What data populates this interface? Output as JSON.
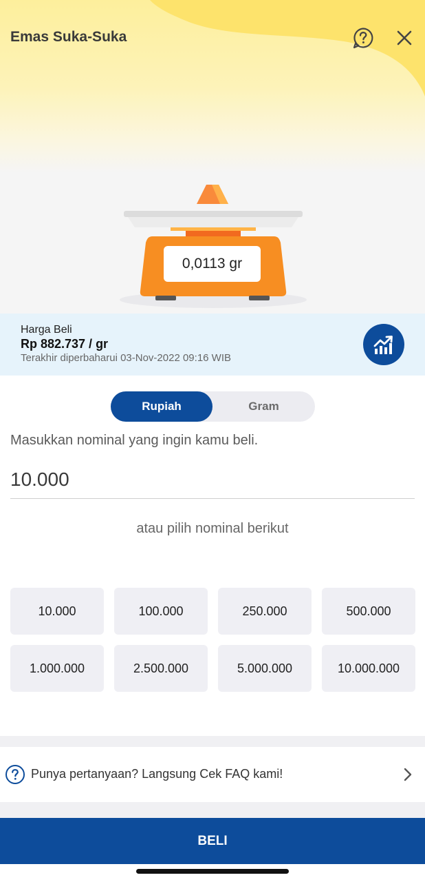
{
  "header": {
    "title": "Emas Suka-Suka",
    "help_icon": "help-icon",
    "close_icon": "close-icon"
  },
  "hero": {
    "weight_display": "0,0113 gr",
    "colors": {
      "yellow": "#fde36c",
      "scale_orange": "#f78e22"
    }
  },
  "price": {
    "label": "Harga Beli",
    "value": "Rp 882.737 / gr",
    "updated": "Terakhir diperbaharui 03-Nov-2022 09:16 WIB",
    "chart_icon": "trend-chart-icon"
  },
  "mode_toggle": {
    "selected": "Rupiah",
    "options": [
      "Rupiah",
      "Gram"
    ]
  },
  "form": {
    "prompt": "Masukkan nominal yang ingin kamu beli.",
    "amount_value": "10.000",
    "or_text": "atau pilih nominal berikut"
  },
  "presets": [
    "10.000",
    "100.000",
    "250.000",
    "500.000",
    "1.000.000",
    "2.500.000",
    "5.000.000",
    "10.000.000"
  ],
  "faq": {
    "text": "Punya pertanyaan? Langsung Cek FAQ kami!"
  },
  "buy_button": {
    "label": "BELI"
  },
  "colors": {
    "primary": "#0d4c9b",
    "price_bar_bg": "#e6f3fb",
    "chip_bg": "#efeff4"
  }
}
